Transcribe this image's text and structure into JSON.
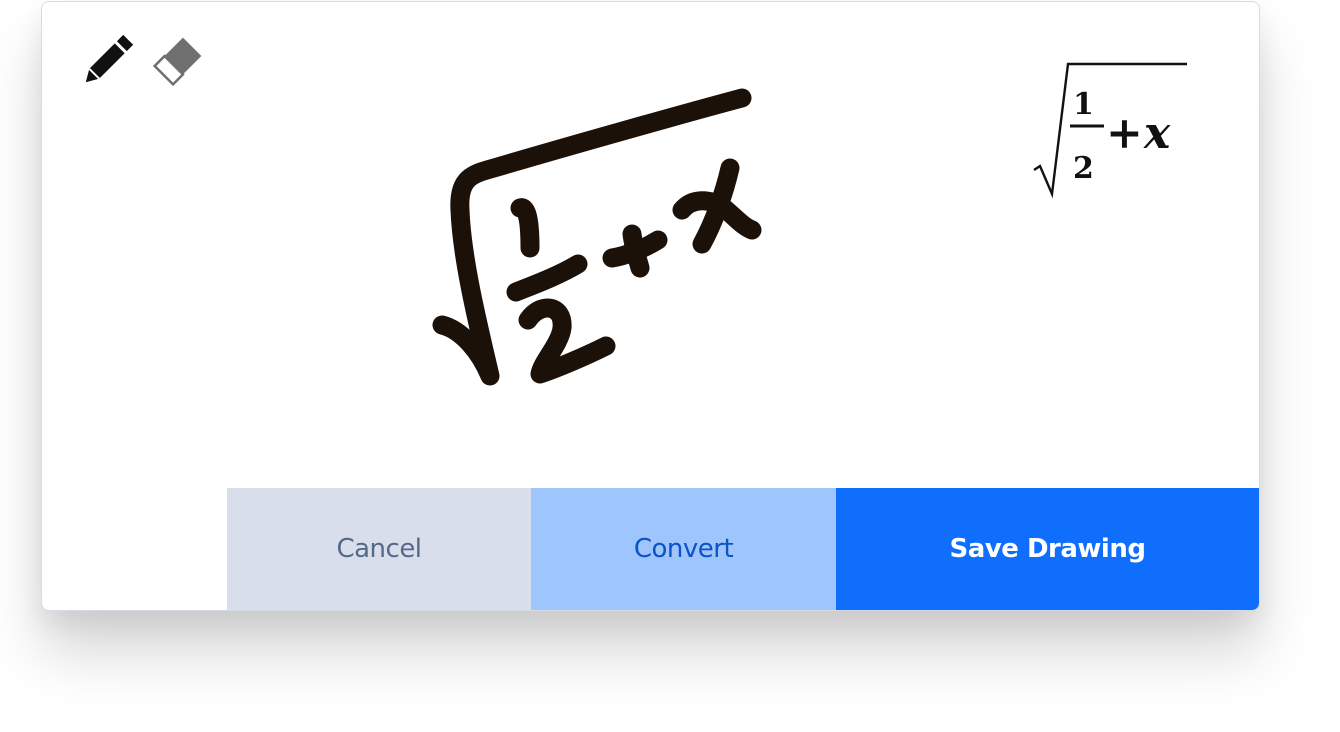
{
  "toolbar": {
    "tools": [
      {
        "icon": "pencil-icon",
        "color": "#111111",
        "active": true
      },
      {
        "icon": "eraser-icon",
        "color": "#6f6f6f",
        "active": false
      }
    ]
  },
  "drawing": {
    "ink_color": "#1c1109",
    "handwritten_expression": "√(1/2 + x)"
  },
  "preview": {
    "expression": "√(1/2 + x)",
    "numerator": "1",
    "denominator": "2",
    "operator": "+",
    "variable": "x"
  },
  "actions": {
    "cancel_label": "Cancel",
    "convert_label": "Convert",
    "save_label": "Save Drawing"
  },
  "colors": {
    "cancel_bg": "#d9dfea",
    "convert_bg": "#9fc5fd",
    "save_bg": "#0f6efc"
  }
}
